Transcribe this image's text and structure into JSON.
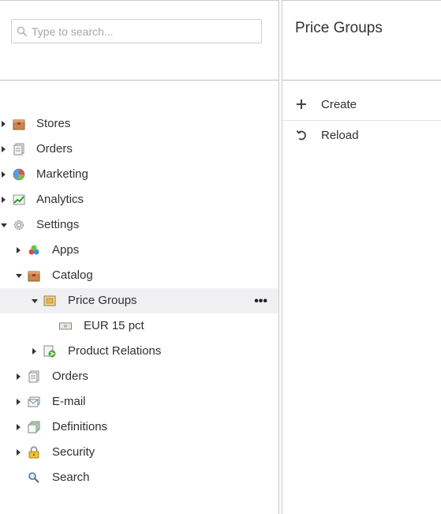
{
  "search": {
    "placeholder": "Type to search..."
  },
  "tree": {
    "stores": "Stores",
    "orders": "Orders",
    "marketing": "Marketing",
    "analytics": "Analytics",
    "settings": "Settings",
    "apps": "Apps",
    "catalog": "Catalog",
    "price_groups": "Price Groups",
    "price_groups_menu": "•••",
    "eur_15_pct": "EUR 15 pct",
    "product_relations": "Product Relations",
    "settings_orders": "Orders",
    "email": "E-mail",
    "definitions": "Definitions",
    "security": "Security",
    "search": "Search"
  },
  "panel": {
    "title": "Price Groups",
    "actions": {
      "create": "Create",
      "reload": "Reload"
    }
  },
  "colors": {
    "selected_row": "#f0f0f2",
    "separator": "#bdbdbd"
  }
}
